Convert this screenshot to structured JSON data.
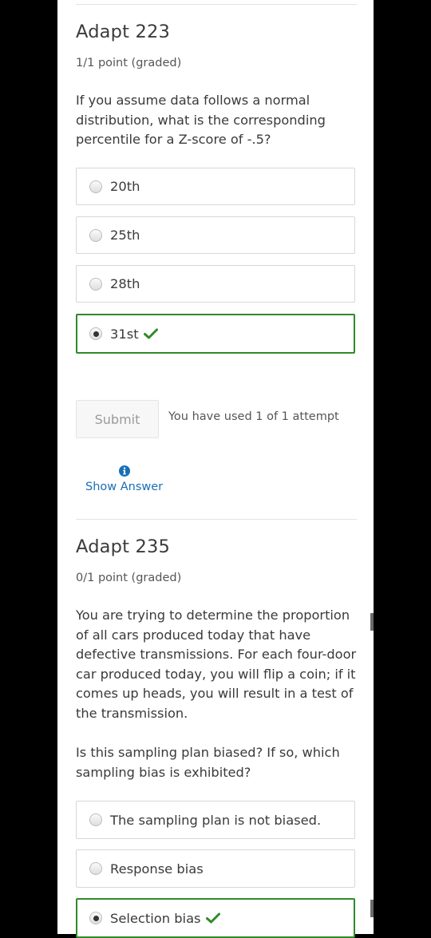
{
  "problem1": {
    "title": "Adapt 223",
    "points": "1/1 point (graded)",
    "question": "If you assume data follows a normal distribution, what is the corresponding percentile for a Z-score of -.5?",
    "choices": [
      {
        "label": "20th",
        "selected": false
      },
      {
        "label": "25th",
        "selected": false
      },
      {
        "label": "28th",
        "selected": false
      },
      {
        "label": "31st",
        "selected": true,
        "status": "correct"
      }
    ],
    "submit_label": "Submit",
    "attempts_text": "You have used 1 of 1 attempt",
    "show_answer_label": "Show Answer"
  },
  "problem2": {
    "title": "Adapt 235",
    "points": "0/1 point (graded)",
    "question_p1": "You are trying to determine the proportion of all cars produced today that have defective transmissions. For each four-door car produced today, you will flip a coin; if it comes up heads, you will result in a test of the transmission.",
    "question_p2": "Is this sampling plan biased? If so, which sampling bias is exhibited?",
    "choices": [
      {
        "label": "The sampling plan is not biased.",
        "selected": false
      },
      {
        "label": "Response bias",
        "selected": false
      },
      {
        "label": "Selection bias",
        "selected": true,
        "status": "correct"
      }
    ]
  },
  "colors": {
    "correct": "#2e8b29",
    "link": "#1a6fb4",
    "background": "#000000"
  }
}
